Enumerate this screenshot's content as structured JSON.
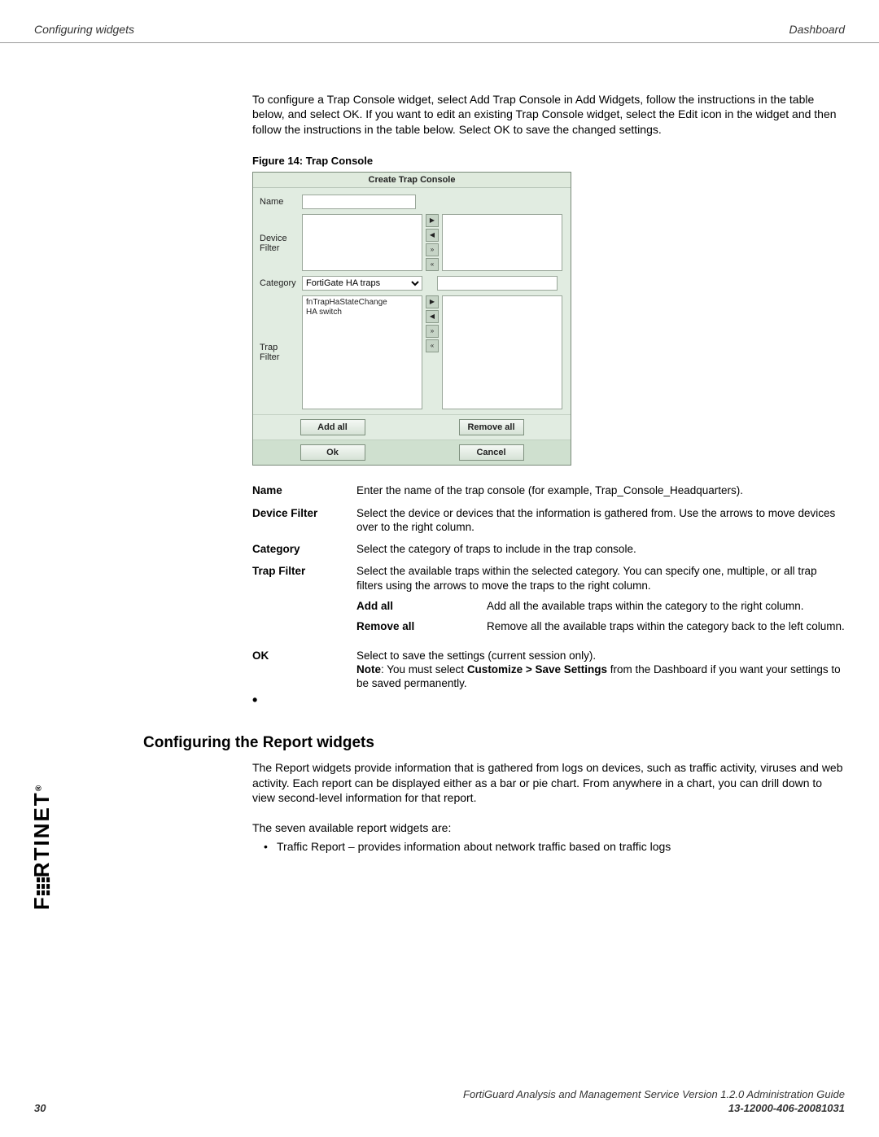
{
  "header": {
    "left": "Configuring widgets",
    "right": "Dashboard"
  },
  "intro_para": "To configure a Trap Console widget, select Add Trap Console in Add Widgets, follow the instructions in the table below, and select OK. If you want to edit an existing Trap Console widget, select the Edit icon in the widget and then follow the instructions in the table below. Select OK to save the changed settings.",
  "figure": {
    "caption": "Figure 14: Trap Console",
    "dialog_title": "Create Trap Console",
    "labels": {
      "name": "Name",
      "device_filter": "Device\nFilter",
      "category": "Category",
      "trap_filter": "Trap\nFilter"
    },
    "category_value": "FortiGate HA traps",
    "trap_items": "fnTrapHaStateChange\nHA switch",
    "buttons": {
      "add_all": "Add all",
      "remove_all": "Remove all",
      "ok": "Ok",
      "cancel": "Cancel"
    }
  },
  "defs": {
    "name": {
      "term": "Name",
      "desc": "Enter the name of the trap console (for example, Trap_Console_Headquarters)."
    },
    "device_filter": {
      "term": "Device Filter",
      "desc": "Select the device or devices that the information is gathered from. Use the arrows to move devices over to the right column."
    },
    "category": {
      "term": "Category",
      "desc": "Select the category of traps to include in the trap console."
    },
    "trap_filter": {
      "term": "Trap Filter",
      "desc": "Select the available traps within the selected category. You can specify one, multiple, or all trap filters using the arrows to move the traps to the right column.",
      "add_all": {
        "term": "Add all",
        "desc": "Add all the available traps within the category to the right column."
      },
      "remove_all": {
        "term": "Remove all",
        "desc": "Remove all the available traps within the category back to the left column."
      }
    },
    "ok": {
      "term": "OK",
      "line1": "Select to save the settings (current session only).",
      "note_prefix": "Note",
      "note_mid": ": You must select ",
      "note_bold": "Customize > Save Settings",
      "note_suffix": " from the Dashboard if you want your settings to be saved permanently."
    }
  },
  "section2": {
    "heading": "Configuring the Report widgets",
    "para1": "The Report widgets provide information that is gathered from logs on devices, such as traffic activity, viruses and web activity. Each report can be displayed either as a bar or pie chart. From anywhere in a chart, you can drill down to view second-level information for that report.",
    "para2": "The seven available report widgets are:",
    "bullet1": "Traffic Report – provides information about network traffic based on traffic logs"
  },
  "footer": {
    "line1": "FortiGuard Analysis and Management Service Version 1.2.0 Administration Guide",
    "page_num": "30",
    "doc_id": "13-12000-406-20081031"
  },
  "logo_text": "F  RTINET"
}
